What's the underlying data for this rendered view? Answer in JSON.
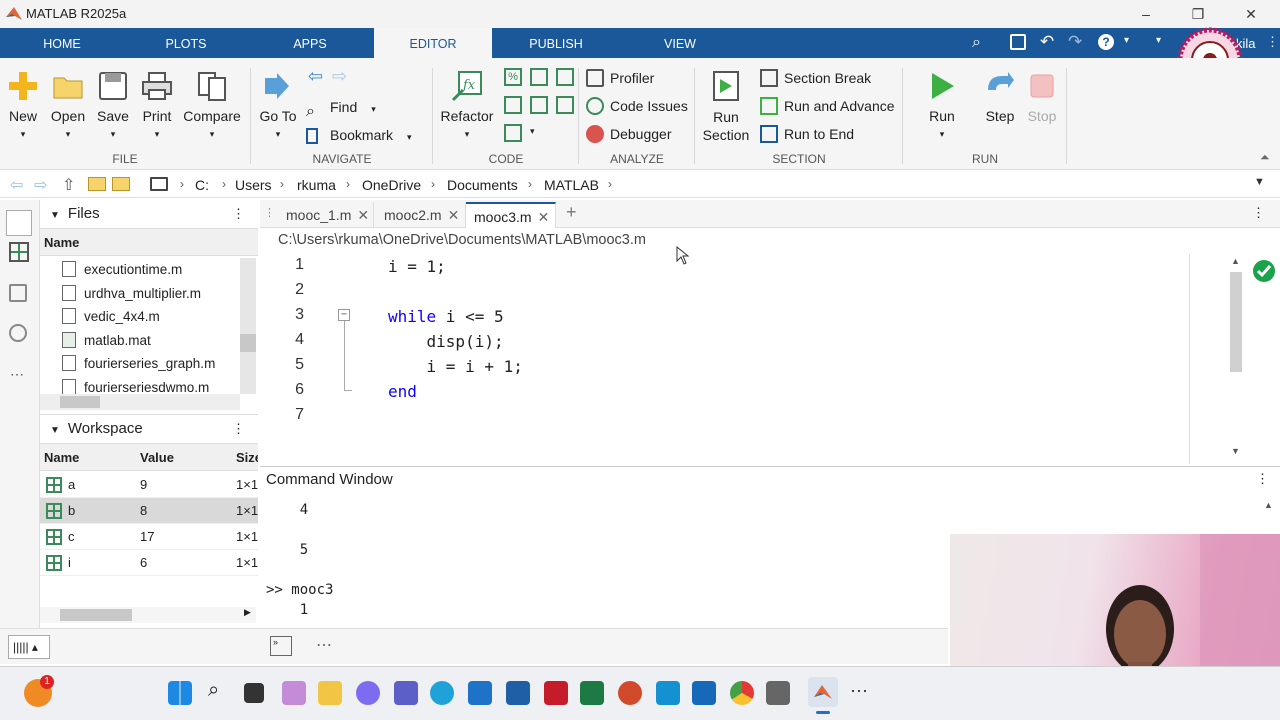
{
  "window": {
    "title": "MATLAB R2025a",
    "user_partial": "kila"
  },
  "tabs": [
    {
      "label": "HOME"
    },
    {
      "label": "PLOTS"
    },
    {
      "label": "APPS"
    },
    {
      "label": "EDITOR"
    },
    {
      "label": "PUBLISH"
    },
    {
      "label": "VIEW"
    }
  ],
  "ribbon": {
    "file": {
      "group": "FILE",
      "new": "New",
      "open": "Open",
      "save": "Save",
      "print": "Print",
      "compare": "Compare"
    },
    "navigate": {
      "group": "NAVIGATE",
      "goto": "Go To",
      "find": "Find",
      "bookmark": "Bookmark"
    },
    "code": {
      "group": "CODE",
      "refactor": "Refactor"
    },
    "analyze": {
      "group": "ANALYZE",
      "profiler": "Profiler",
      "code_issues": "Code Issues",
      "debugger": "Debugger"
    },
    "section": {
      "group": "SECTION",
      "run_section_1": "Run",
      "run_section_2": "Section",
      "section_break": "Section Break",
      "run_advance": "Run and Advance",
      "run_to_end": "Run to End"
    },
    "run": {
      "group": "RUN",
      "run": "Run",
      "step": "Step",
      "stop": "Stop"
    }
  },
  "address": {
    "crumbs": [
      "C:",
      "Users",
      "rkuma",
      "OneDrive",
      "Documents",
      "MATLAB"
    ]
  },
  "files": {
    "title": "Files",
    "col_name": "Name",
    "items": [
      "executiontime.m",
      "urdhva_multiplier.m",
      "vedic_4x4.m",
      "matlab.mat",
      "fourierseries_graph.m",
      "fourierseriesdwmo.m"
    ]
  },
  "workspace": {
    "title": "Workspace",
    "col_name": "Name",
    "col_value": "Value",
    "col_size": "Size",
    "size_partial": "Size",
    "rows": [
      {
        "name": "a",
        "value": "9",
        "size": "1×1"
      },
      {
        "name": "b",
        "value": "8",
        "size": "1×1"
      },
      {
        "name": "c",
        "value": "17",
        "size": "1×1"
      },
      {
        "name": "i",
        "value": "6",
        "size": "1×1"
      }
    ]
  },
  "editor": {
    "tabs": [
      "mooc_1.m",
      "mooc2.m",
      "mooc3.m"
    ],
    "path": "C:\\Users\\rkuma\\OneDrive\\Documents\\MATLAB\\mooc3.m",
    "lines": [
      {
        "n": "1",
        "text": "i = 1;"
      },
      {
        "n": "2",
        "text": ""
      },
      {
        "n": "3",
        "kw": "while",
        "text": " i <= 5"
      },
      {
        "n": "4",
        "text": "    disp(i);"
      },
      {
        "n": "5",
        "text": "    i = i + 1;"
      },
      {
        "n": "6",
        "kw": "end",
        "text": ""
      },
      {
        "n": "7",
        "text": ""
      }
    ]
  },
  "command": {
    "title": "Command Window",
    "lines": [
      "    4",
      "",
      "",
      "    5",
      "",
      "",
      ">> mooc3",
      "    1"
    ]
  },
  "colors": {
    "accent": "#1b5899",
    "keyword": "#0e00ff",
    "run_green": "#3cb043"
  },
  "taskbar": {
    "badge": "1"
  }
}
